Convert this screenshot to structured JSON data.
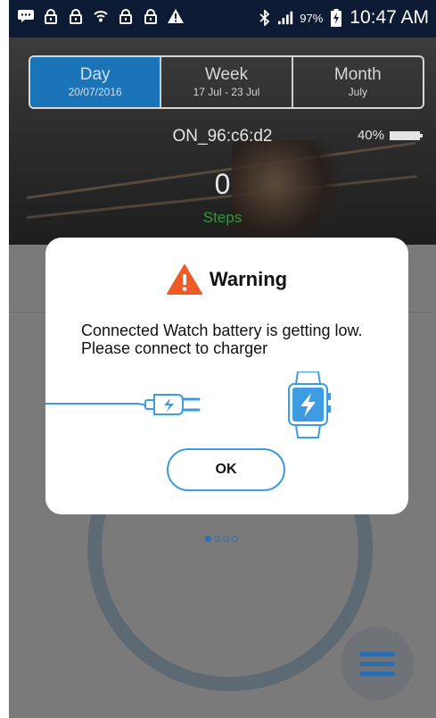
{
  "status_bar": {
    "battery_percent": "97%",
    "time": "10:47 AM"
  },
  "tabs": [
    {
      "title": "Day",
      "subtitle": "20/07/2016",
      "active": true
    },
    {
      "title": "Week",
      "subtitle": "17 Jul - 23 Jul",
      "active": false
    },
    {
      "title": "Month",
      "subtitle": "July",
      "active": false
    }
  ],
  "device": {
    "name": "ON_96:c6:d2",
    "battery": "40%"
  },
  "steps": {
    "value": "0",
    "label": "Steps"
  },
  "dialog": {
    "title": "Warning",
    "message": "Connected Watch battery is getting low. Please connect to charger",
    "ok_label": "OK"
  },
  "colors": {
    "active_tab": "#1b73b8",
    "steps_label": "#2e9b38",
    "warning": "#f05a28",
    "button_border": "#3d9be2"
  },
  "pager": {
    "total": 4,
    "active_index": 0
  }
}
